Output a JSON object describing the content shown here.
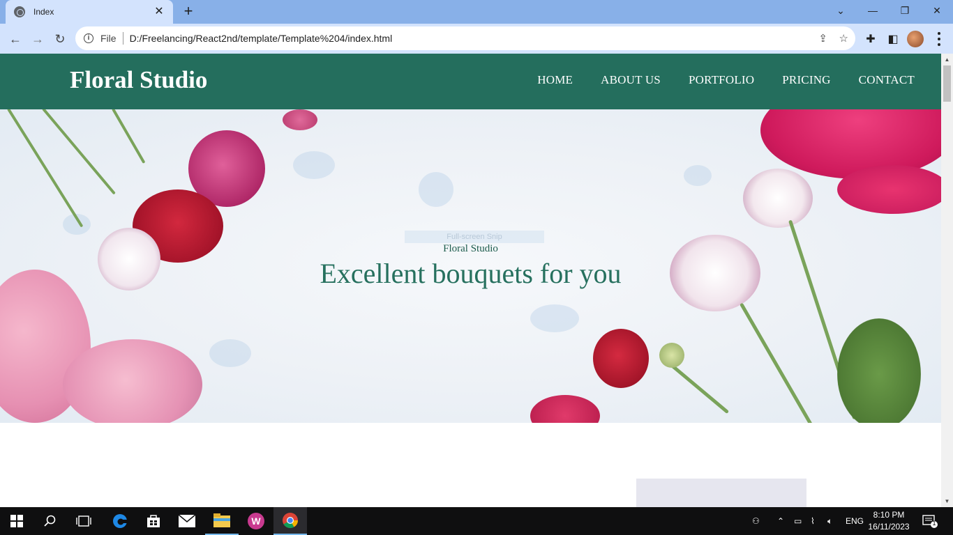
{
  "browser": {
    "tab_title": "Index",
    "omnibox_label": "File",
    "url": "D:/Freelancing/React2nd/template/Template%204/index.html"
  },
  "site": {
    "brand": "Floral Studio",
    "nav": [
      "HOME",
      "ABOUT US",
      "PORTFOLIO",
      "PRICING",
      "CONTACT"
    ],
    "hero_subtitle": "Floral Studio",
    "hero_title": "Excellent bouquets for you",
    "snip_overlay": "Full-screen Snip"
  },
  "taskbar": {
    "language": "ENG",
    "time": "8:10 PM",
    "date": "16/11/2023",
    "notifications": "1"
  },
  "colors": {
    "header_bg": "#246e5d",
    "hero_title": "#26705e",
    "browser_frame": "#88b0e8",
    "toolbar": "#d3e3fd"
  },
  "icons": [
    "globe-icon",
    "close-icon",
    "plus-icon",
    "back-icon",
    "forward-icon",
    "reload-icon",
    "info-icon",
    "share-icon",
    "star-icon",
    "puzzle-icon",
    "sidepanel-icon",
    "kebab-icon",
    "windows-icon",
    "search-icon",
    "taskview-icon",
    "edge-icon",
    "store-icon",
    "mail-icon",
    "explorer-icon",
    "wps-icon",
    "chrome-icon"
  ]
}
